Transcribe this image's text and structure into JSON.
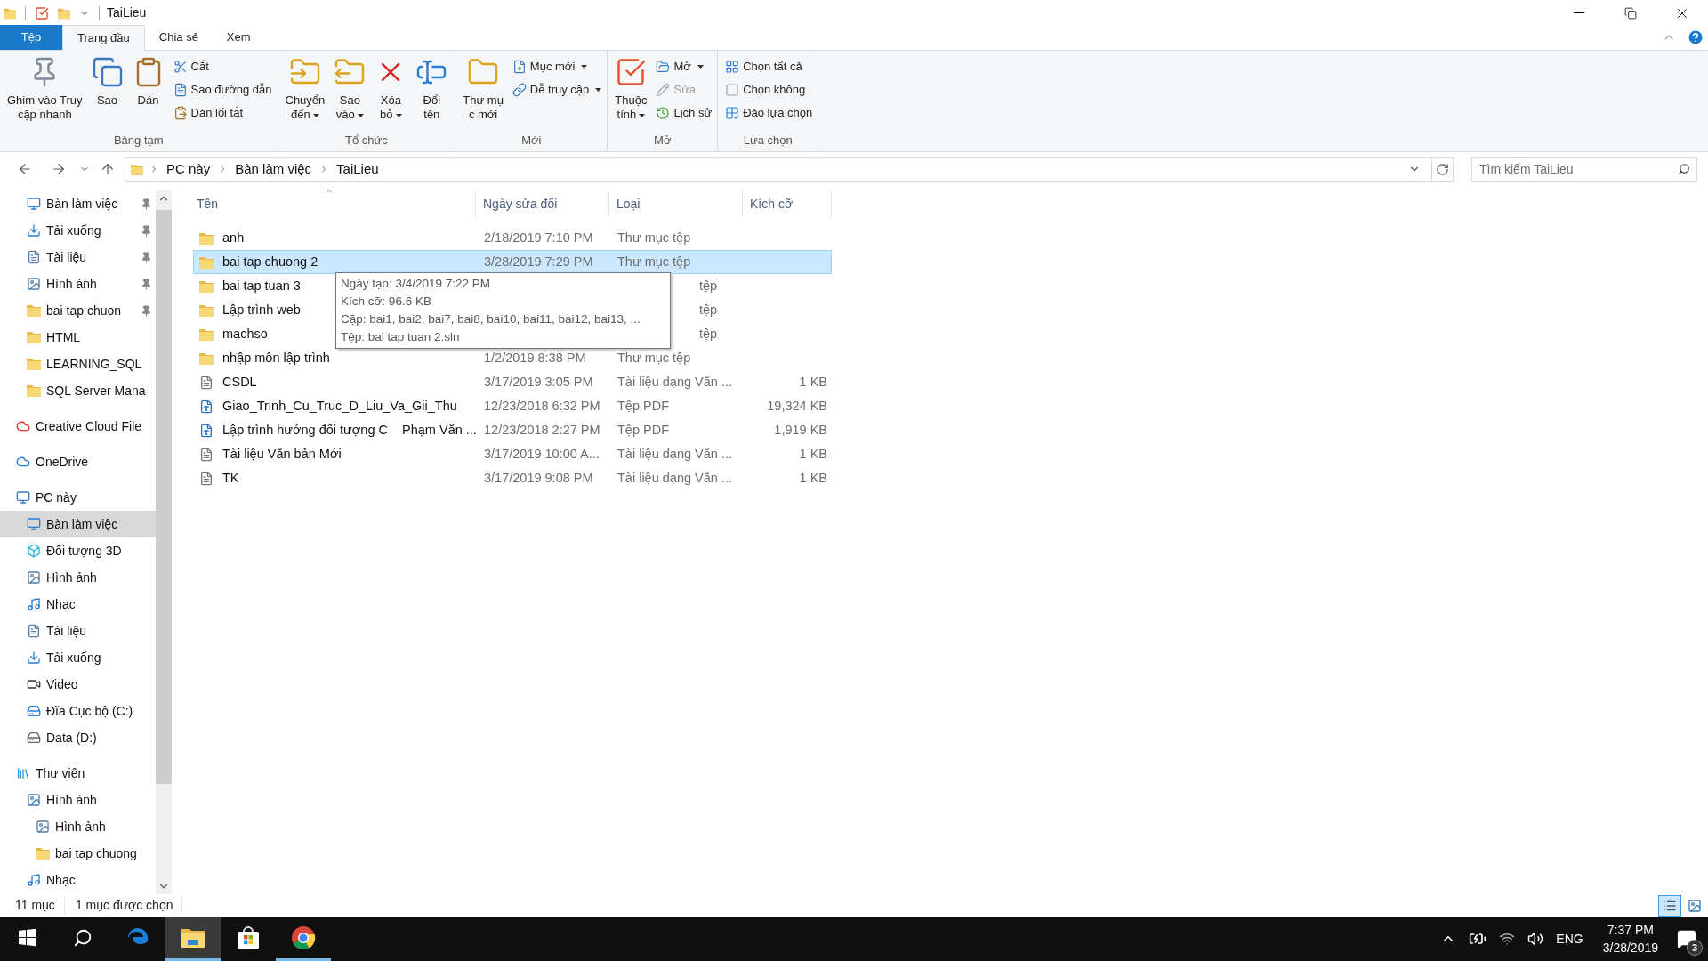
{
  "title_bar": {
    "title": "TaiLieu"
  },
  "ribbon_tabs": [
    {
      "label": "Tệp",
      "kind": "file",
      "selected": false
    },
    {
      "label": "Trang đầu",
      "kind": "tab",
      "selected": true
    },
    {
      "label": "Chia sẻ",
      "kind": "tab",
      "selected": false
    },
    {
      "label": "Xem",
      "kind": "tab",
      "selected": false
    }
  ],
  "ribbon_groups": [
    {
      "label": "Bảng tạm",
      "items": [
        {
          "label": "Ghim vào Truy\ncập nhanh",
          "kind": "large",
          "dropdown": false,
          "disabled": false
        },
        {
          "label": "Sao",
          "kind": "large",
          "dropdown": false,
          "disabled": false
        },
        {
          "label": "Dán",
          "kind": "large",
          "dropdown": false,
          "disabled": false
        },
        {
          "label": "Cắt",
          "kind": "small",
          "dropdown": false,
          "disabled": false
        },
        {
          "label": "Sao đường dẫn",
          "kind": "small",
          "dropdown": false,
          "disabled": false
        },
        {
          "label": "Dán lối tắt",
          "kind": "small",
          "dropdown": false,
          "disabled": false
        }
      ]
    },
    {
      "label": "Tổ chức",
      "items": [
        {
          "label": "Chuyển\nđến",
          "kind": "large",
          "dropdown": true,
          "disabled": false
        },
        {
          "label": "Sao\nvào",
          "kind": "large",
          "dropdown": true,
          "disabled": false
        },
        {
          "label": "Xóa\nbỏ",
          "kind": "large",
          "dropdown": true,
          "disabled": false
        },
        {
          "label": "Đổi\ntên",
          "kind": "large",
          "dropdown": false,
          "disabled": false
        }
      ]
    },
    {
      "label": "Mới",
      "items": [
        {
          "label": "Thư mụ\nc mới",
          "kind": "large",
          "dropdown": false,
          "disabled": false
        },
        {
          "label": "Mục mới",
          "kind": "small",
          "dropdown": true,
          "disabled": false
        },
        {
          "label": "Dễ truy cập",
          "kind": "small",
          "dropdown": true,
          "disabled": false
        }
      ]
    },
    {
      "label": "Mở",
      "items": [
        {
          "label": "Thuộc\ntính",
          "kind": "large",
          "dropdown": true,
          "disabled": false
        },
        {
          "label": "Mở",
          "kind": "small",
          "dropdown": true,
          "disabled": false
        },
        {
          "label": "Sửa",
          "kind": "small",
          "dropdown": false,
          "disabled": true
        },
        {
          "label": "Lịch sử",
          "kind": "small",
          "dropdown": false,
          "disabled": false
        }
      ]
    },
    {
      "label": "Lựa chọn",
      "items": [
        {
          "label": "Chọn tất cả",
          "kind": "small",
          "dropdown": false,
          "disabled": false
        },
        {
          "label": "Chọn không",
          "kind": "small",
          "dropdown": false,
          "disabled": false
        },
        {
          "label": "Đảo lựa chọn",
          "kind": "small",
          "dropdown": false,
          "disabled": false
        }
      ]
    }
  ],
  "address_bar": {
    "breadcrumbs": [
      "PC này",
      "Bàn làm việc",
      "TaiLieu"
    ]
  },
  "search": {
    "placeholder": "Tìm kiếm TaiLieu"
  },
  "sidebar": {
    "quick_access": [
      {
        "label": "Bàn làm việc",
        "kind": "desktop",
        "pinned": true,
        "selected": false
      },
      {
        "label": "Tải xuống",
        "kind": "downloads",
        "pinned": true,
        "selected": false
      },
      {
        "label": "Tài liệu",
        "kind": "documents",
        "pinned": true,
        "selected": false
      },
      {
        "label": "Hình ảnh",
        "kind": "pictures",
        "pinned": true,
        "selected": false
      },
      {
        "label": "bai tap chuon",
        "kind": "folder",
        "pinned": true,
        "selected": false
      },
      {
        "label": "HTML",
        "kind": "folder",
        "pinned": false,
        "selected": false
      },
      {
        "label": "LEARNING_SQL",
        "kind": "folder",
        "pinned": false,
        "selected": false
      },
      {
        "label": "SQL Server Mana",
        "kind": "folder",
        "pinned": false,
        "selected": false
      }
    ],
    "tree": [
      {
        "label": "Creative Cloud File",
        "kind": "creative-cloud",
        "selected": false
      },
      {
        "label": "OneDrive",
        "kind": "cloud",
        "selected": false
      },
      {
        "label": "PC này",
        "kind": "pc",
        "selected": false,
        "children": [
          {
            "label": "Bàn làm việc",
            "kind": "desktop",
            "selected": true
          },
          {
            "label": "Đối tượng 3D",
            "kind": "objects3d",
            "selected": false
          },
          {
            "label": "Hình ảnh",
            "kind": "pictures",
            "selected": false
          },
          {
            "label": "Nhạc",
            "kind": "music",
            "selected": false
          },
          {
            "label": "Tài liệu",
            "kind": "documents",
            "selected": false
          },
          {
            "label": "Tải xuống",
            "kind": "downloads",
            "selected": false
          },
          {
            "label": "Video",
            "kind": "video",
            "selected": false
          },
          {
            "label": "Đĩa Cục bộ (C:)",
            "kind": "system-drive",
            "selected": false
          },
          {
            "label": "Data (D:)",
            "kind": "drive",
            "selected": false
          }
        ]
      },
      {
        "label": "Thư viện",
        "kind": "library",
        "selected": false,
        "children": [
          {
            "label": "Hình ảnh",
            "kind": "picture-library",
            "selected": false,
            "children": [
              {
                "label": "Hình ảnh",
                "kind": "pictures",
                "selected": false
              },
              {
                "label": "bai tap chuong",
                "kind": "folder",
                "selected": false
              }
            ]
          },
          {
            "label": "Nhạc",
            "kind": "music-library",
            "selected": false
          }
        ]
      }
    ]
  },
  "columns": [
    "Tên",
    "Ngày sửa đổi",
    "Loại",
    "Kích cỡ"
  ],
  "files": [
    {
      "name": "anh",
      "date": "2/18/2019 7:10 PM",
      "type": "Thư mục tệp",
      "kind": "folder",
      "selected": false
    },
    {
      "name": "bai tap chuong 2",
      "date": "3/28/2019 7:29 PM",
      "type": "Thư mục tệp",
      "kind": "folder",
      "selected": true
    },
    {
      "name": "bai tap tuan 3",
      "type": "tệp",
      "type_covered": true,
      "kind": "folder",
      "selected": false
    },
    {
      "name": "Lập trình web",
      "type": "tệp",
      "type_covered": true,
      "kind": "folder",
      "selected": false
    },
    {
      "name": "machso",
      "type": "tệp",
      "type_covered": true,
      "kind": "folder",
      "selected": false
    },
    {
      "name": "nhập môn lập trình",
      "date": "1/2/2019 8:38 PM",
      "type": "Thư mục tệp",
      "kind": "folder",
      "selected": false
    },
    {
      "name": "CSDL",
      "date": "3/17/2019 3:05 PM",
      "type": "Tài liệu dạng Văn ...",
      "size": "1 KB",
      "kind": "text",
      "selected": false
    },
    {
      "name": "Giao_Trinh_Cu_Truc_D_Liu_Va_Gii_Thu",
      "date": "12/23/2018 6:32 PM",
      "type": "Tệp PDF",
      "size": "19,324 KB",
      "kind": "pdf",
      "selected": false
    },
    {
      "name": "Lập trình hướng đối tượng C    Phạm Văn ...",
      "date": "12/23/2018 2:27 PM",
      "type": "Tệp PDF",
      "size": "1,919 KB",
      "kind": "pdf",
      "selected": false
    },
    {
      "name": "Tài liệu Văn bản Mới",
      "date": "3/17/2019 10:00 A...",
      "type": "Tài liệu dạng Văn ...",
      "size": "1 KB",
      "kind": "text",
      "selected": false
    },
    {
      "name": "TK",
      "date": "3/17/2019 9:08 PM",
      "type": "Tài liệu dạng Văn ...",
      "size": "1 KB",
      "kind": "text",
      "selected": false
    }
  ],
  "tooltip": {
    "lines": [
      "Ngày tạo: 3/4/2019 7:22 PM",
      "Kích cỡ: 96.6 KB",
      "Cặp: bai1, bai2, bai7, bai8, bai10, bai11, bai12, bai13, ...",
      "Tệp: bai tap tuan 2.sln"
    ]
  },
  "status_bar": {
    "item_count": "11 mục",
    "selection": "1 mục được chọn",
    "view_buttons": [
      {
        "kind": "details",
        "selected": true
      },
      {
        "kind": "large-icons",
        "selected": false
      }
    ]
  },
  "taskbar": {
    "apps": [
      {
        "kind": "start",
        "active": false,
        "running": false
      },
      {
        "kind": "search",
        "active": false,
        "running": false
      },
      {
        "kind": "edge",
        "active": false,
        "running": false
      },
      {
        "kind": "explorer",
        "active": true,
        "running": true
      },
      {
        "kind": "store",
        "active": false,
        "running": false
      },
      {
        "kind": "chrome",
        "active": false,
        "running": true
      }
    ],
    "language": "ENG",
    "time": "7:37 PM",
    "date": "3/28/2019",
    "notification_count": "3"
  }
}
